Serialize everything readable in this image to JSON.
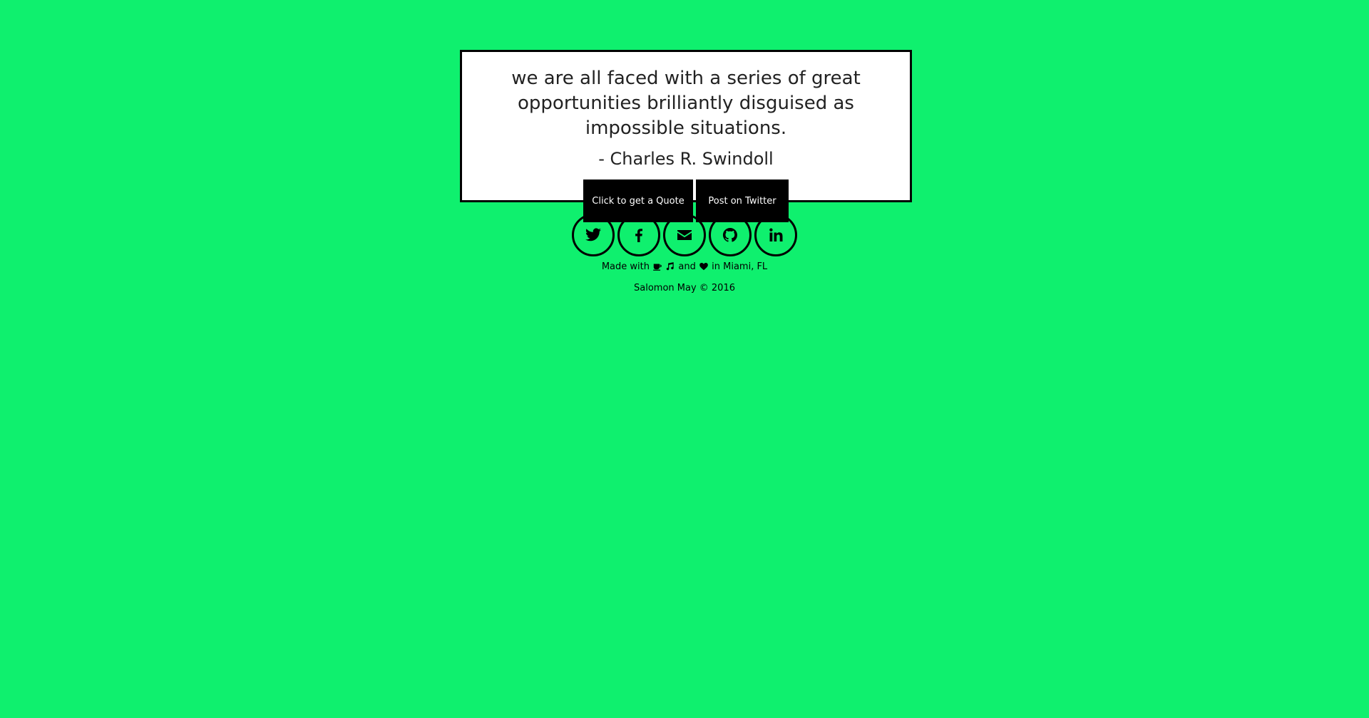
{
  "quote": {
    "text": "we are all faced with a series of great opportunities brilliantly disguised as impossible situations.",
    "author": "- Charles R. Swindoll"
  },
  "buttons": {
    "get_quote": "Click to get a Quote",
    "post_twitter": "Post on Twitter"
  },
  "social": [
    {
      "icon": "twitter-icon"
    },
    {
      "icon": "facebook-icon"
    },
    {
      "icon": "envelope-icon"
    },
    {
      "icon": "github-icon"
    },
    {
      "icon": "linkedin-icon"
    }
  ],
  "footer": {
    "made_prefix": "Made with",
    "made_and": "and",
    "made_suffix": "in Miami, FL",
    "copyright": "Salomon May © 2016"
  },
  "colors": {
    "background": "#0ff06e",
    "card": "#ffffff",
    "button": "#000000"
  }
}
